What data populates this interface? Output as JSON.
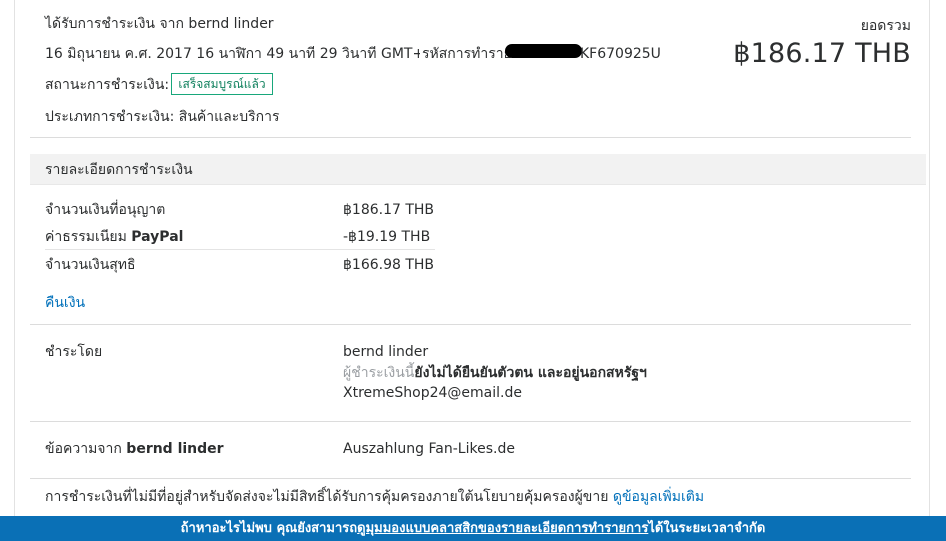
{
  "header": {
    "received_from": "ได้รับการชำระเงิน จาก bernd linder",
    "datetime": "16 มิถุนายน ค.ศ. 2017 16 นาฬิกา 49 นาที 29 วินาที GMT+02:00",
    "txn_label": "รหัสการทำรายการ:",
    "txn_suffix": "KF670925U",
    "status_label": "สถานะการชำระเงิน:",
    "status_badge": "เสร็จสมบูรณ์แล้ว",
    "payment_type": "ประเภทการชำระเงิน: สินค้าและบริการ",
    "total_label": "ยอดรวม",
    "total_amount": "฿186.17 THB"
  },
  "details": {
    "title": "รายละเอียดการชำระเงิน",
    "rows": [
      {
        "label": "จำนวนเงินที่อนุญาต",
        "value": "฿186.17 THB"
      },
      {
        "label": "ค่าธรรมเนียม ",
        "label_bold": "PayPal",
        "value": "-฿19.19 THB"
      },
      {
        "label": "จำนวนเงินสุทธิ",
        "value": "฿166.98 THB"
      }
    ],
    "refund_link": "คืนเงิน"
  },
  "payer": {
    "label": "ชำระโดย",
    "name": "bernd linder",
    "status_prefix": "ผู้ชำระเงินนี้",
    "status_bold": "ยังไม่ได้ยืนยันตัวตน และอยู่นอกสหรัฐฯ",
    "email": "XtremeShop24@email.de"
  },
  "message": {
    "label_prefix": "ข้อความจาก ",
    "label_bold": "bernd linder",
    "text": "Auszahlung Fan-Likes.de"
  },
  "protection": {
    "text": "การชำระเงินที่ไม่มีที่อยู่สำหรับจัดส่งจะไม่มีสิทธิ์ได้รับการคุ้มครองภายใต้นโยบายคุ้มครองผู้ขาย ",
    "link": "ดูข้อมูลเพิ่มเติม"
  },
  "footer": {
    "part1": "ถ้าหาอะไรไม่พบ คุณยังสามารถ",
    "link1": "ดูมุมมองแบบคลาสสิกของรายละเอียดการทำรายการ",
    "part2": "ได้ในระยะเวลาจำกัด"
  },
  "colors": {
    "accent_link": "#0070ba",
    "footer_bg": "#0a70b6",
    "status_green": "#18a77b"
  }
}
